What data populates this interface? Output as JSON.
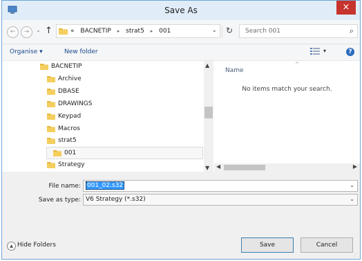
{
  "window": {
    "title": "Save As",
    "close_glyph": "×",
    "accent": "#c7332d"
  },
  "nav": {
    "back_glyph": "←",
    "forward_glyph": "→",
    "history_glyph": "⌄",
    "up_glyph": "↑",
    "breadcrumb": [
      "«",
      "BACNETIP",
      "strat5",
      "001"
    ],
    "breadcrumb_sep": "▸",
    "dropdown_glyph": "⌄",
    "refresh_glyph": "↻",
    "search_placeholder": "Search 001",
    "search_glyph": "⌕"
  },
  "toolbar": {
    "organise": "Organise ▾",
    "new_folder": "New folder",
    "view_dropdown": "▾",
    "help": "?"
  },
  "tree": {
    "items": [
      {
        "label": "BACNETIP",
        "icon": "folder-icon"
      },
      {
        "label": "Archive",
        "icon": "folder-icon"
      },
      {
        "label": "DBASE",
        "icon": "folder-icon"
      },
      {
        "label": "DRAWINGS",
        "icon": "folder-icon"
      },
      {
        "label": "Keypad",
        "icon": "folder-icon"
      },
      {
        "label": "Macros",
        "icon": "folder-icon"
      },
      {
        "label": "strat5",
        "icon": "folder-icon"
      },
      {
        "label": "001",
        "icon": "folder-icon",
        "selected": true
      },
      {
        "label": "Strategy",
        "icon": "folder-icon"
      }
    ]
  },
  "scroll": {
    "up": "▲",
    "down": "▼",
    "left": "◀",
    "right": "▶"
  },
  "list": {
    "column_name": "Name",
    "sort_glyph": "^",
    "empty_message": "No items match your search."
  },
  "form": {
    "file_name_label": "File name:",
    "file_name_value": "001_02.s32",
    "save_as_type_label": "Save as type:",
    "save_as_type_value": "V6 Strategy (*.s32)",
    "dropdown_glyph": "⌄"
  },
  "footer": {
    "hide_folders_label": "Hide Folders",
    "hide_folders_glyph": "▲",
    "save_label": "Save",
    "cancel_label": "Cancel",
    "grip_glyph": "⋰"
  }
}
